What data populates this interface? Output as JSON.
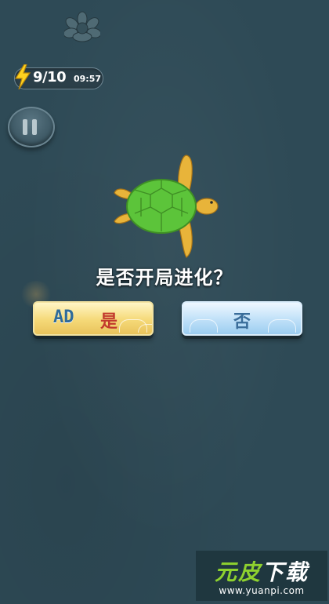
{
  "hud": {
    "energy_count": "9/10",
    "energy_timer": "09:57"
  },
  "dialog": {
    "question": "是否开局进化？",
    "yes_button": {
      "ad_label": "AD",
      "label": "是"
    },
    "no_button": {
      "label": "否"
    }
  },
  "watermark": {
    "title_part1": "元皮",
    "title_part2": "下载",
    "url": "www.yuanpi.com"
  },
  "icons": {
    "energy": "lightning-bolt-icon",
    "pause": "pause-icon",
    "top": "lotus-icon",
    "character": "turtle"
  },
  "colors": {
    "background": "#2e4a56",
    "yes_button": "#f5d978",
    "no_button": "#bfe0f8",
    "turtle_shell": "#5cc43a",
    "turtle_limbs": "#e8b43a"
  }
}
